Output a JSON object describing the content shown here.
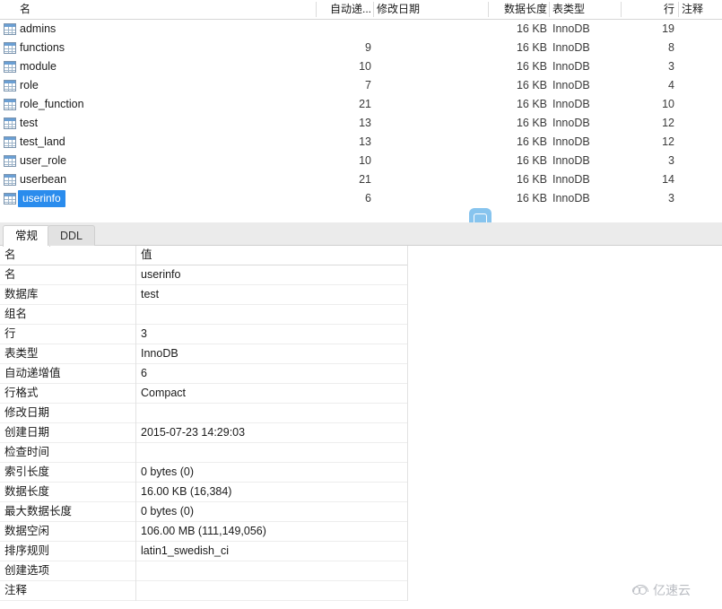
{
  "grid": {
    "columns": [
      {
        "key": "name",
        "label": "名"
      },
      {
        "key": "auto_inc",
        "label": "自动递..."
      },
      {
        "key": "modified",
        "label": "修改日期"
      },
      {
        "key": "data_len",
        "label": "数据长度"
      },
      {
        "key": "engine",
        "label": "表类型"
      },
      {
        "key": "rows",
        "label": "行"
      },
      {
        "key": "comment",
        "label": "注释"
      }
    ],
    "rows": [
      {
        "name": "admins",
        "auto_inc": "",
        "modified": "",
        "data_len": "16 KB",
        "engine": "InnoDB",
        "rows": "19",
        "comment": "",
        "selected": false
      },
      {
        "name": "functions",
        "auto_inc": "9",
        "modified": "",
        "data_len": "16 KB",
        "engine": "InnoDB",
        "rows": "8",
        "comment": "",
        "selected": false
      },
      {
        "name": "module",
        "auto_inc": "10",
        "modified": "",
        "data_len": "16 KB",
        "engine": "InnoDB",
        "rows": "3",
        "comment": "",
        "selected": false
      },
      {
        "name": "role",
        "auto_inc": "7",
        "modified": "",
        "data_len": "16 KB",
        "engine": "InnoDB",
        "rows": "4",
        "comment": "",
        "selected": false
      },
      {
        "name": "role_function",
        "auto_inc": "21",
        "modified": "",
        "data_len": "16 KB",
        "engine": "InnoDB",
        "rows": "10",
        "comment": "",
        "selected": false
      },
      {
        "name": "test",
        "auto_inc": "13",
        "modified": "",
        "data_len": "16 KB",
        "engine": "InnoDB",
        "rows": "12",
        "comment": "",
        "selected": false
      },
      {
        "name": "test_land",
        "auto_inc": "13",
        "modified": "",
        "data_len": "16 KB",
        "engine": "InnoDB",
        "rows": "12",
        "comment": "",
        "selected": false
      },
      {
        "name": "user_role",
        "auto_inc": "10",
        "modified": "",
        "data_len": "16 KB",
        "engine": "InnoDB",
        "rows": "3",
        "comment": "",
        "selected": false
      },
      {
        "name": "userbean",
        "auto_inc": "21",
        "modified": "",
        "data_len": "16 KB",
        "engine": "InnoDB",
        "rows": "14",
        "comment": "",
        "selected": false
      },
      {
        "name": "userinfo",
        "auto_inc": "6",
        "modified": "",
        "data_len": "16 KB",
        "engine": "InnoDB",
        "rows": "3",
        "comment": "",
        "selected": true
      }
    ]
  },
  "badge": {
    "icon": "info-badge-icon"
  },
  "tabs": [
    {
      "id": "general",
      "label": "常规",
      "active": true
    },
    {
      "id": "ddl",
      "label": "DDL",
      "active": false
    }
  ],
  "properties": {
    "header": {
      "name": "名",
      "value": "值"
    },
    "rows": [
      {
        "name": "名",
        "value": "userinfo"
      },
      {
        "name": "数据库",
        "value": "test"
      },
      {
        "name": "组名",
        "value": ""
      },
      {
        "name": "行",
        "value": "3"
      },
      {
        "name": "表类型",
        "value": "InnoDB"
      },
      {
        "name": "自动递增值",
        "value": "6"
      },
      {
        "name": "行格式",
        "value": "Compact"
      },
      {
        "name": "修改日期",
        "value": ""
      },
      {
        "name": "创建日期",
        "value": "2015-07-23 14:29:03"
      },
      {
        "name": "检查时间",
        "value": ""
      },
      {
        "name": "索引长度",
        "value": "0 bytes (0)"
      },
      {
        "name": "数据长度",
        "value": "16.00 KB (16,384)"
      },
      {
        "name": "最大数据长度",
        "value": "0 bytes (0)"
      },
      {
        "name": "数据空闲",
        "value": "106.00 MB (111,149,056)"
      },
      {
        "name": "排序规则",
        "value": "latin1_swedish_ci"
      },
      {
        "name": "创建选项",
        "value": ""
      },
      {
        "name": "注释",
        "value": ""
      }
    ]
  },
  "watermark": {
    "text": "亿速云",
    "logo": "cloud-logo-icon"
  },
  "colors": {
    "selection": "#2a8ced",
    "badge": "#87c4ee",
    "tab_active": "#ffffff",
    "tab_inactive": "#e2e2e2",
    "grid_line": "#ededed",
    "watermark": "#b9bcc2"
  }
}
